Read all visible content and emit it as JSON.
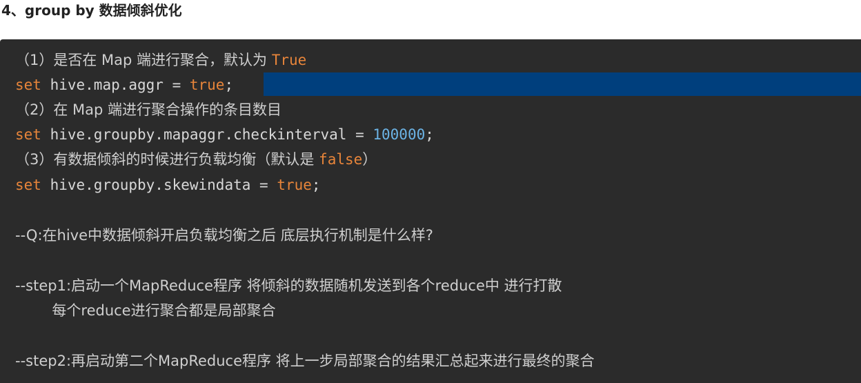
{
  "heading": "4、group by 数据倾斜优化",
  "code": {
    "c1_prefix": "（1）是否在 Map 端进行聚合，默认为 ",
    "c1_value": "True",
    "l1_kw": "set",
    "l1_body": " hive.map.aggr = ",
    "l1_value": "true",
    "l1_end": ";",
    "c2": "（2）在 Map 端进行聚合操作的条目数目",
    "l2_kw": "set",
    "l2_body": " hive.groupby.mapaggr.checkinterval = ",
    "l2_value": "100000",
    "l2_end": ";",
    "c3_prefix": "（3）有数据倾斜的时候进行负载均衡（默认是 ",
    "c3_value": "false",
    "c3_suffix": "）",
    "l3_kw": "set",
    "l3_body": " hive.groupby.skewindata = ",
    "l3_value": "true",
    "l3_end": ";",
    "q": "--Q:在hive中数据倾斜开启负载均衡之后 底层执行机制是什么样?",
    "step1": "--step1:启动一个MapReduce程序 将倾斜的数据随机发送到各个reduce中 进行打散",
    "step1_cont": "        每个reduce进行聚合都是局部聚合",
    "step2": "--step2:再启动第二个MapReduce程序 将上一步局部聚合的结果汇总起来进行最终的聚合"
  },
  "colors": {
    "background": "#2b2b2b",
    "keyword": "#e8853a",
    "number": "#6cb4e6",
    "selection": "#003f7d"
  }
}
